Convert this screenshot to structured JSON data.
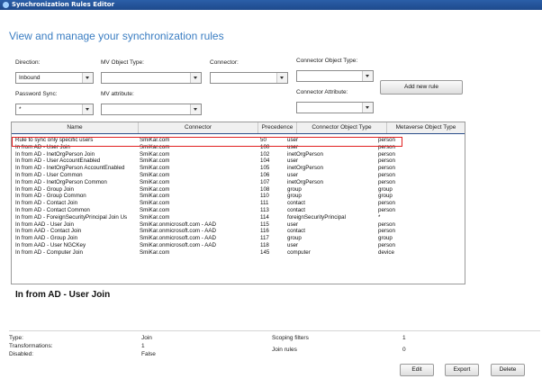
{
  "window": {
    "title": "Synchronization Rules Editor"
  },
  "page": {
    "heading": "View and manage your synchronization rules"
  },
  "filters": {
    "direction_label": "Direction:",
    "direction_value": "Inbound",
    "mv_object_type_label": "MV Object Type:",
    "mv_object_type_value": "",
    "connector_label": "Connector:",
    "connector_value": "",
    "connector_object_type_label": "Connector Object Type:",
    "connector_object_type_value": "",
    "password_sync_label": "Password Sync:",
    "password_sync_value": "*",
    "mv_attribute_label": "MV attribute:",
    "mv_attribute_value": "",
    "connector_attribute_label": "Connector Attribute:",
    "connector_attribute_value": "",
    "add_new_rule_label": "Add new rule"
  },
  "table": {
    "columns": [
      "Name",
      "Connector",
      "Precedence",
      "Connector Object Type",
      "Metaverse Object Type"
    ],
    "rows": [
      [
        "Rule to sync only specific users",
        "SmiKar.com",
        "50",
        "user",
        "person"
      ],
      [
        "In from AD - User Join",
        "SmiKar.com",
        "100",
        "user",
        "person"
      ],
      [
        "In from AD - InetOrgPerson Join",
        "SmiKar.com",
        "102",
        "inetOrgPerson",
        "person"
      ],
      [
        "In from AD - User AccountEnabled",
        "SmiKar.com",
        "104",
        "user",
        "person"
      ],
      [
        "In from AD - InetOrgPerson AccountEnabled",
        "SmiKar.com",
        "105",
        "inetOrgPerson",
        "person"
      ],
      [
        "In from AD - User Common",
        "SmiKar.com",
        "106",
        "user",
        "person"
      ],
      [
        "In from AD - InetOrgPerson Common",
        "SmiKar.com",
        "107",
        "inetOrgPerson",
        "person"
      ],
      [
        "In from AD - Group Join",
        "SmiKar.com",
        "108",
        "group",
        "group"
      ],
      [
        "In from AD - Group Common",
        "SmiKar.com",
        "110",
        "group",
        "group"
      ],
      [
        "In from AD - Contact Join",
        "SmiKar.com",
        "111",
        "contact",
        "person"
      ],
      [
        "In from AD - Contact Common",
        "SmiKar.com",
        "113",
        "contact",
        "person"
      ],
      [
        "In from AD - ForeignSecurityPrincipal Join Us",
        "SmiKar.com",
        "114",
        "foreignSecurityPrincipal",
        "*"
      ],
      [
        "In from AAD - User Join",
        "SmiKar.onmicrosoft.com - AAD",
        "115",
        "user",
        "person"
      ],
      [
        "In from AAD - Contact Join",
        "SmiKar.onmicrosoft.com - AAD",
        "116",
        "contact",
        "person"
      ],
      [
        "In from AAD - Group Join",
        "SmiKar.onmicrosoft.com - AAD",
        "117",
        "group",
        "group"
      ],
      [
        "In from AAD - User NGCKey",
        "SmiKar.onmicrosoft.com - AAD",
        "118",
        "user",
        "person"
      ],
      [
        "In from AD - Computer Join",
        "SmiKar.com",
        "145",
        "computer",
        "device"
      ]
    ]
  },
  "details": {
    "title": "In from AD - User Join",
    "type_label": "Type:",
    "type_value": "Join",
    "transformations_label": "Transformations:",
    "transformations_value": "1",
    "disabled_label": "Disabled:",
    "disabled_value": "False",
    "scoping_filters_label": "Scoping filters",
    "scoping_filters_value": "1",
    "join_rules_label": "Join rules",
    "join_rules_value": "0"
  },
  "actions": {
    "edit_label": "Edit",
    "export_label": "Export",
    "delete_label": "Delete"
  },
  "colors": {
    "heading": "#3a7dc2",
    "highlight_border": "#e02020",
    "titlebar": "#2b5fa8"
  }
}
